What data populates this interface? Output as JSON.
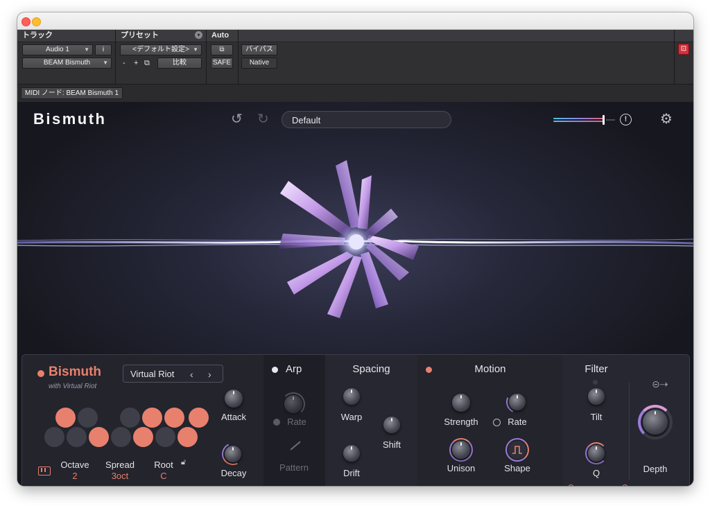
{
  "host": {
    "sections": {
      "track": "トラック",
      "preset": "プリセット",
      "auto": "Auto"
    },
    "track_name": "Audio 1",
    "track_i": "i",
    "plugin_name": "BEAM Bismuth",
    "preset_value": "<デフォルト設定>",
    "minus": "-",
    "plus": "+",
    "compare": "比較",
    "safe": "SAFE",
    "bypass": "バイパス",
    "native": "Native",
    "midi_node": "MIDI ノード: BEAM Bismuth 1"
  },
  "plugin": {
    "brand": "Bismuth",
    "preset": "Default",
    "output_level": 0.93,
    "synth": {
      "name": "Bismuth",
      "byline": "with Virtual Riot",
      "preset_name": "Virtual Riot",
      "prev_icon": "chevron-left-icon",
      "next_icon": "chevron-right-icon",
      "keyboard_dots": [
        true,
        false,
        false,
        true,
        true,
        true,
        false,
        false,
        true,
        false,
        true,
        false
      ],
      "octave_label": "Octave",
      "octave_value": "2",
      "spread_label": "Spread",
      "spread_value": "3oct",
      "root_label": "Root",
      "root_value": "C",
      "attack_label": "Attack",
      "decay_label": "Decay"
    },
    "arp": {
      "title": "Arp",
      "rate_label": "Rate",
      "pattern_label": "Pattern"
    },
    "spacing": {
      "title": "Spacing",
      "warp_label": "Warp",
      "shift_label": "Shift",
      "drift_label": "Drift"
    },
    "motion": {
      "title": "Motion",
      "strength_label": "Strength",
      "rate_label": "Rate",
      "unison_label": "Unison",
      "shape_label": "Shape"
    },
    "filter": {
      "title": "Filter",
      "tilt_label": "Tilt",
      "q_label": "Q",
      "depth_label": "Depth"
    }
  },
  "colors": {
    "accent": "#e8806e",
    "purple": "#9c7bd9",
    "panel": "#23242c"
  }
}
